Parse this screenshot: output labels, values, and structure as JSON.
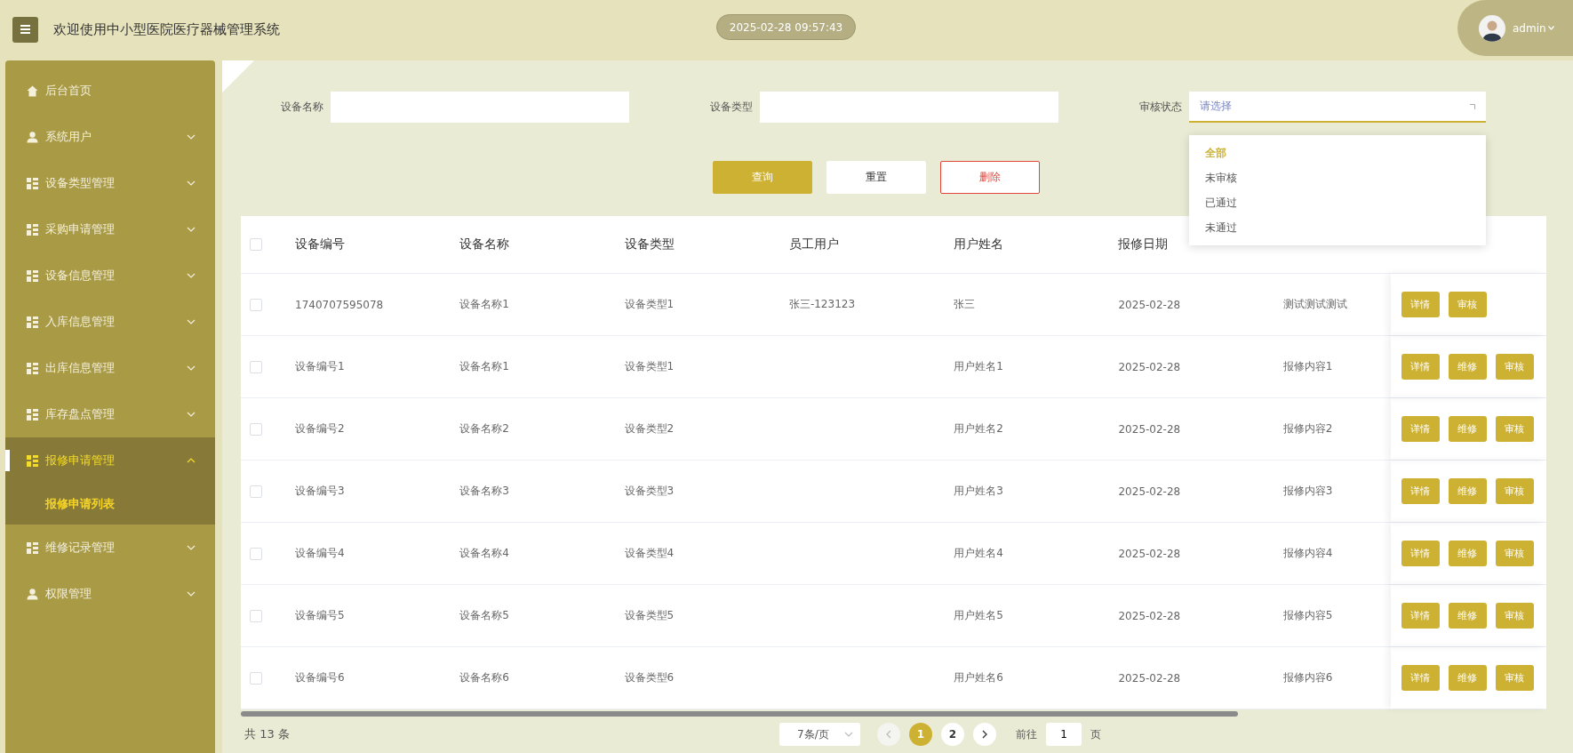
{
  "header": {
    "title": "欢迎使用中小型医院医疗器械管理系统",
    "datetime": "2025-02-28 09:57:43",
    "user": "admin"
  },
  "sidebar": {
    "items": [
      {
        "kind": "home",
        "label": "后台首页",
        "selected": false
      },
      {
        "kind": "user",
        "label": "系统用户",
        "selected": false,
        "expanded": false
      },
      {
        "kind": "grid",
        "label": "设备类型管理",
        "selected": false,
        "expanded": false
      },
      {
        "kind": "grid",
        "label": "采购申请管理",
        "selected": false,
        "expanded": false
      },
      {
        "kind": "grid",
        "label": "设备信息管理",
        "selected": false,
        "expanded": false
      },
      {
        "kind": "grid",
        "label": "入库信息管理",
        "selected": false,
        "expanded": false
      },
      {
        "kind": "grid",
        "label": "出库信息管理",
        "selected": false,
        "expanded": false
      },
      {
        "kind": "grid",
        "label": "库存盘点管理",
        "selected": false,
        "expanded": false
      },
      {
        "kind": "grid",
        "label": "报修申请管理",
        "selected": true,
        "expanded": true,
        "children": [
          {
            "label": "报修申请列表",
            "selected": true
          }
        ]
      },
      {
        "kind": "grid",
        "label": "维修记录管理",
        "selected": false,
        "expanded": false
      },
      {
        "kind": "user",
        "label": "权限管理",
        "selected": false,
        "expanded": false
      }
    ]
  },
  "filters": [
    {
      "kind": "input",
      "label": "设备名称"
    },
    {
      "kind": "input",
      "label": "设备类型"
    },
    {
      "kind": "select",
      "label": "审核状态",
      "placeholder": "请选择",
      "expanded": true,
      "options": [
        {
          "label": "全部",
          "selected": true
        },
        {
          "label": "未审核",
          "selected": false
        },
        {
          "label": "已通过",
          "selected": false
        },
        {
          "label": "未通过",
          "selected": false
        }
      ]
    }
  ],
  "actions": [
    {
      "kind": "primary",
      "label": "查询"
    },
    {
      "kind": "plain",
      "label": "重置"
    },
    {
      "kind": "danger",
      "label": "删除"
    }
  ],
  "table": {
    "select_all_checked": false,
    "columns": [
      "设备编号",
      "设备名称",
      "设备类型",
      "员工用户",
      "用户姓名",
      "报修日期"
    ],
    "rows": [
      {
        "checked": false,
        "cells": [
          "1740707595078",
          "设备名称1",
          "设备类型1",
          "张三-123123",
          "张三",
          "2025-02-28",
          "测试测试测试"
        ],
        "buttons": [
          "详情",
          "审核"
        ]
      },
      {
        "checked": false,
        "cells": [
          "设备编号1",
          "设备名称1",
          "设备类型1",
          null,
          "用户姓名1",
          "2025-02-28",
          "报修内容1"
        ],
        "buttons": [
          "详情",
          "维修",
          "审核"
        ]
      },
      {
        "checked": false,
        "cells": [
          "设备编号2",
          "设备名称2",
          "设备类型2",
          null,
          "用户姓名2",
          "2025-02-28",
          "报修内容2"
        ],
        "buttons": [
          "详情",
          "维修",
          "审核"
        ]
      },
      {
        "checked": false,
        "cells": [
          "设备编号3",
          "设备名称3",
          "设备类型3",
          null,
          "用户姓名3",
          "2025-02-28",
          "报修内容3"
        ],
        "buttons": [
          "详情",
          "维修",
          "审核"
        ]
      },
      {
        "checked": false,
        "cells": [
          "设备编号4",
          "设备名称4",
          "设备类型4",
          null,
          "用户姓名4",
          "2025-02-28",
          "报修内容4"
        ],
        "buttons": [
          "详情",
          "维修",
          "审核"
        ]
      },
      {
        "checked": false,
        "cells": [
          "设备编号5",
          "设备名称5",
          "设备类型5",
          null,
          "用户姓名5",
          "2025-02-28",
          "报修内容5"
        ],
        "buttons": [
          "详情",
          "维修",
          "审核"
        ]
      },
      {
        "checked": false,
        "cells": [
          "设备编号6",
          "设备名称6",
          "设备类型6",
          null,
          "用户姓名6",
          "2025-02-28",
          "报修内容6"
        ],
        "buttons": [
          "详情",
          "维修",
          "审核"
        ]
      }
    ]
  },
  "pagination": {
    "total": "共 13 条",
    "page_size": "7条/页",
    "pages": [
      {
        "label": "1",
        "selected": true
      },
      {
        "label": "2",
        "selected": false
      }
    ],
    "goto_label": "前往",
    "goto_value": "1",
    "goto_suffix": "页"
  }
}
